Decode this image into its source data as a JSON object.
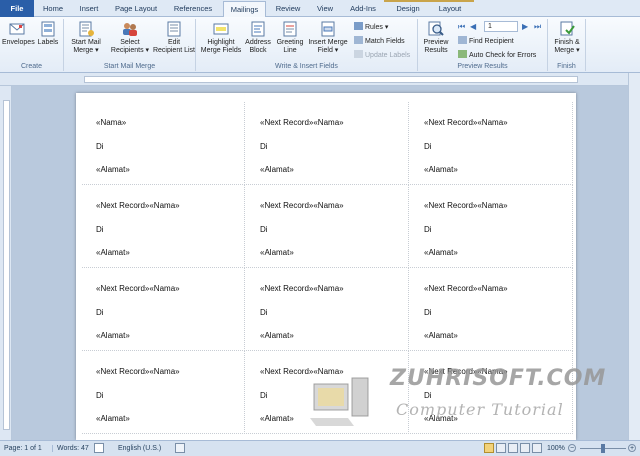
{
  "tabs": [
    "File",
    "Home",
    "Insert",
    "Page Layout",
    "References",
    "Mailings",
    "Review",
    "View",
    "Add-Ins",
    "Design",
    "Layout"
  ],
  "active_tab": "Mailings",
  "ribbon": {
    "create": {
      "label": "Create",
      "envelopes": "Envelopes",
      "labels": "Labels"
    },
    "start_mail_merge": {
      "label": "Start Mail Merge",
      "start": [
        "Start Mail",
        "Merge ▾"
      ],
      "select": [
        "Select",
        "Recipients ▾"
      ],
      "edit": [
        "Edit",
        "Recipient List"
      ]
    },
    "write_insert": {
      "label": "Write & Insert Fields",
      "highlight": [
        "Highlight",
        "Merge Fields"
      ],
      "address": [
        "Address",
        "Block"
      ],
      "greeting": [
        "Greeting",
        "Line"
      ],
      "insert": [
        "Insert Merge",
        "Field ▾"
      ],
      "rules": "Rules ▾",
      "match": "Match Fields",
      "update": "Update Labels"
    },
    "preview": {
      "label": "Preview Results",
      "preview_btn": [
        "Preview",
        "Results"
      ],
      "record": "1",
      "find": "Find Recipient",
      "auto_check": "Auto Check for Errors"
    },
    "finish": {
      "label": "Finish",
      "btn": [
        "Finish &",
        "Merge ▾"
      ]
    }
  },
  "cells": [
    [
      "«Nama»",
      "Di",
      "«Alamat»"
    ],
    [
      "«Next Record»«Nama»",
      "Di",
      "«Alamat»"
    ],
    [
      "«Next Record»«Nama»",
      "Di",
      "«Alamat»"
    ],
    [
      "«Next Record»«Nama»",
      "Di",
      "«Alamat»"
    ],
    [
      "«Next Record»«Nama»",
      "Di",
      "«Alamat»"
    ],
    [
      "«Next Record»«Nama»",
      "Di",
      "«Alamat»"
    ],
    [
      "«Next Record»«Nama»",
      "Di",
      "«Alamat»"
    ],
    [
      "«Next Record»«Nama»",
      "Di",
      "«Alamat»"
    ],
    [
      "«Next Record»«Nama»",
      "Di",
      "«Alamat»"
    ],
    [
      "«Next Record»«Nama»",
      "Di",
      "«Alamat»"
    ],
    [
      "«Next Record»«Nama»",
      "Di",
      "«Alamat»"
    ],
    [
      "«Next Record»«Nama»",
      "Di",
      "«Alamat»"
    ]
  ],
  "watermark": {
    "title": "ZUHRISOFT.COM",
    "subtitle": "Computer Tutorial"
  },
  "status": {
    "page": "Page: 1 of 1",
    "words": "Words: 47",
    "language": "English (U.S.)",
    "zoom": "100%"
  }
}
